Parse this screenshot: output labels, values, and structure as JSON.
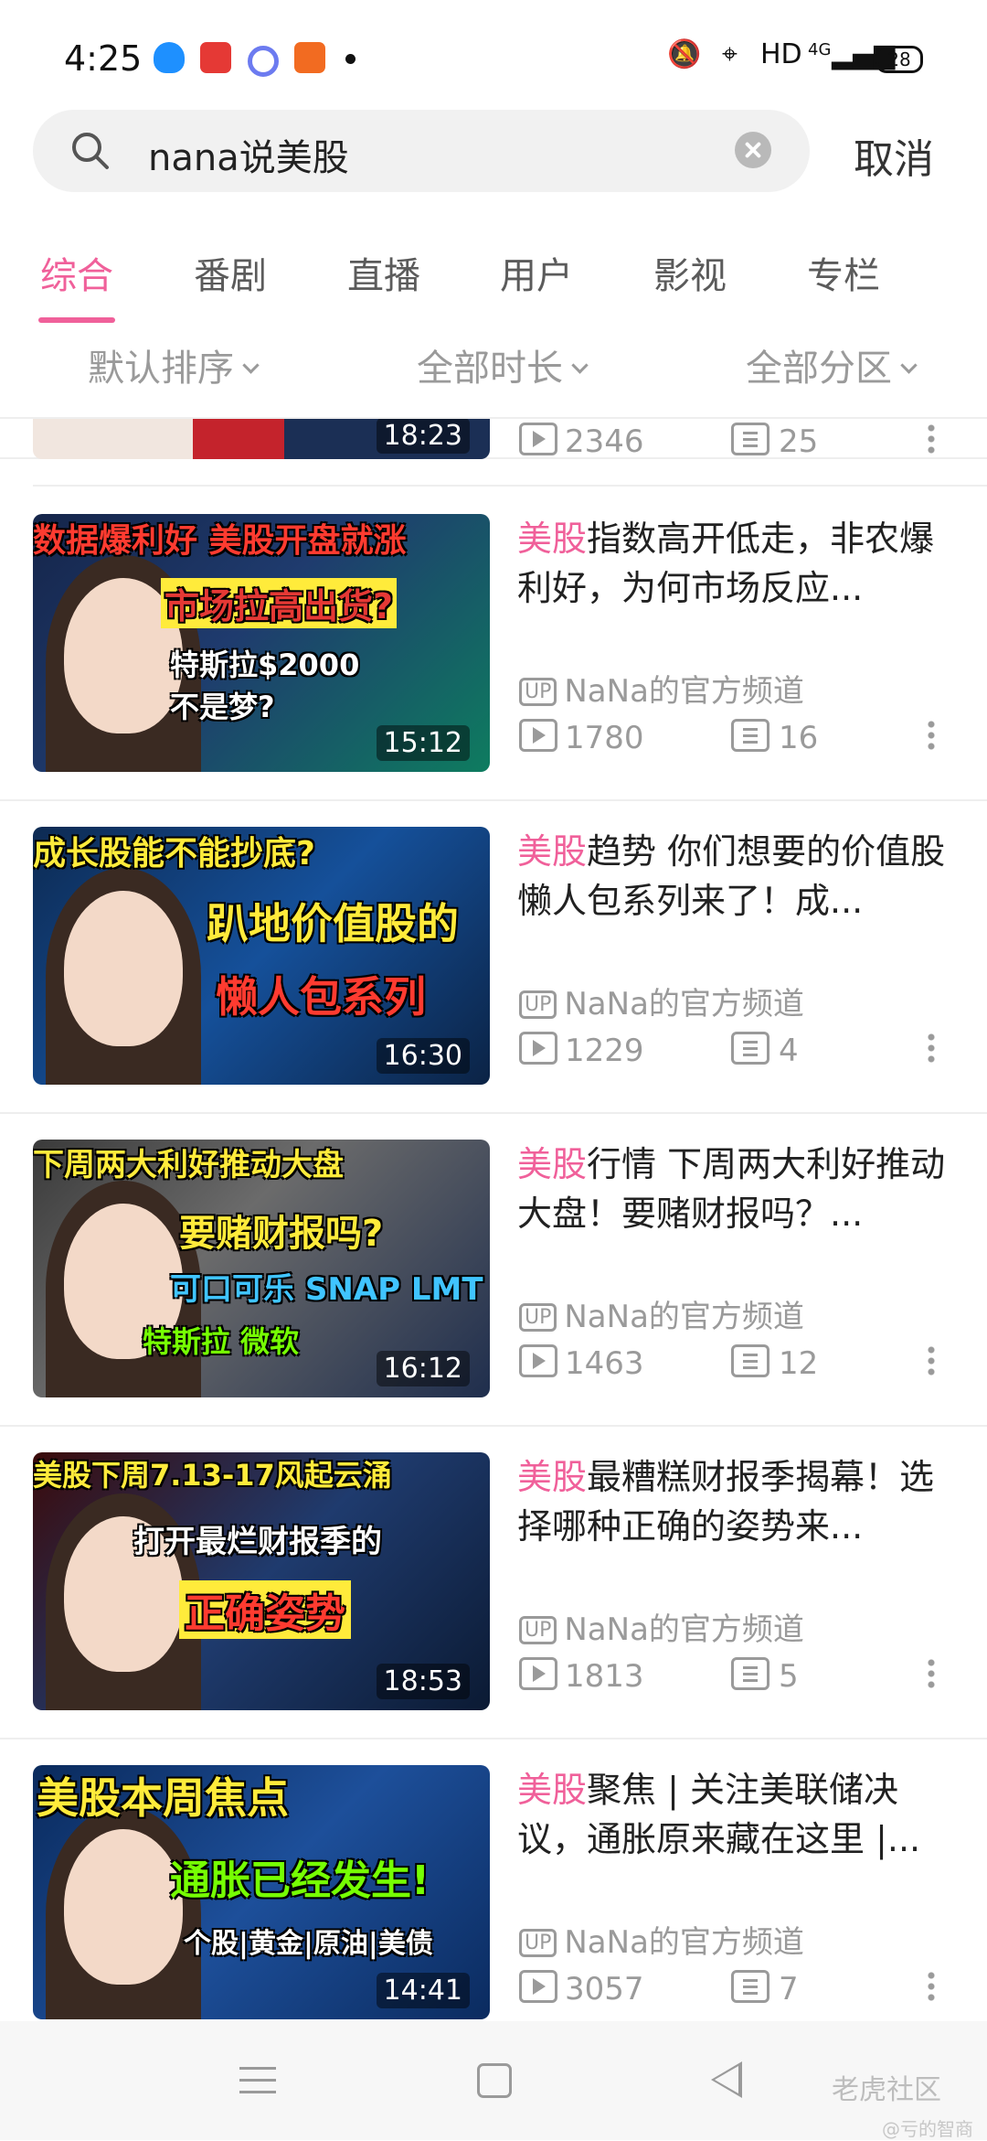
{
  "status_bar": {
    "time": "4:25",
    "network": "HD",
    "signal": "4G",
    "battery": "28"
  },
  "search": {
    "query": "nana说美股",
    "cancel_label": "取消"
  },
  "tabs": [
    {
      "label": "综合"
    },
    {
      "label": "番剧"
    },
    {
      "label": "直播"
    },
    {
      "label": "用户"
    },
    {
      "label": "影视"
    },
    {
      "label": "专栏"
    }
  ],
  "filters": [
    {
      "label": "默认排序"
    },
    {
      "label": "全部时长"
    },
    {
      "label": "全部分区"
    }
  ],
  "partial_item": {
    "duration": "18:23",
    "views": "2346",
    "danmaku": "25"
  },
  "items": [
    {
      "title_hl": "美股",
      "title_rest": "指数高开低走，非农爆利好，为何市场反应...",
      "uploader": "NaNa的官方频道",
      "views": "1780",
      "danmaku": "16",
      "duration": "15:12",
      "thumb_lines": [
        "数据爆利好 美股开盘就涨",
        "市场拉高出货?",
        "特斯拉$2000",
        "不是梦?"
      ]
    },
    {
      "title_hl": "美股",
      "title_rest": "趋势 你们想要的价值股懒人包系列来了！成...",
      "uploader": "NaNa的官方频道",
      "views": "1229",
      "danmaku": "4",
      "duration": "16:30",
      "thumb_lines": [
        "成长股能不能抄底?",
        "趴地价值股的",
        "懒人包系列"
      ]
    },
    {
      "title_hl": "美股",
      "title_rest": "行情 下周两大利好推动大盘！要赌财报吗？...",
      "uploader": "NaNa的官方频道",
      "views": "1463",
      "danmaku": "12",
      "duration": "16:12",
      "thumb_lines": [
        "下周两大利好推动大盘",
        "要赌财报吗?",
        "可口可乐 SNAP LMT",
        "特斯拉 微软"
      ]
    },
    {
      "title_hl": "美股",
      "title_rest": "最糟糕财报季揭幕！选择哪种正确的姿势来...",
      "uploader": "NaNa的官方频道",
      "views": "1813",
      "danmaku": "5",
      "duration": "18:53",
      "thumb_lines": [
        "美股下周7.13-17风起云涌",
        "打开最烂财报季的",
        "正确姿势"
      ]
    },
    {
      "title_hl": "美股",
      "title_rest": "聚焦 | 关注美联储决议，通胀原来藏在这里 |...",
      "uploader": "NaNa的官方频道",
      "views": "3057",
      "danmaku": "7",
      "duration": "14:41",
      "thumb_lines": [
        "美股本周焦点",
        "通胀已经发生!",
        "个股|黄金|原油|美债"
      ]
    }
  ],
  "up_badge": "UP",
  "watermark": {
    "brand": "老虎社区",
    "sub": "@亏的智商"
  },
  "colors": {
    "accent": "#f0609a",
    "muted": "#9a9a9a"
  }
}
